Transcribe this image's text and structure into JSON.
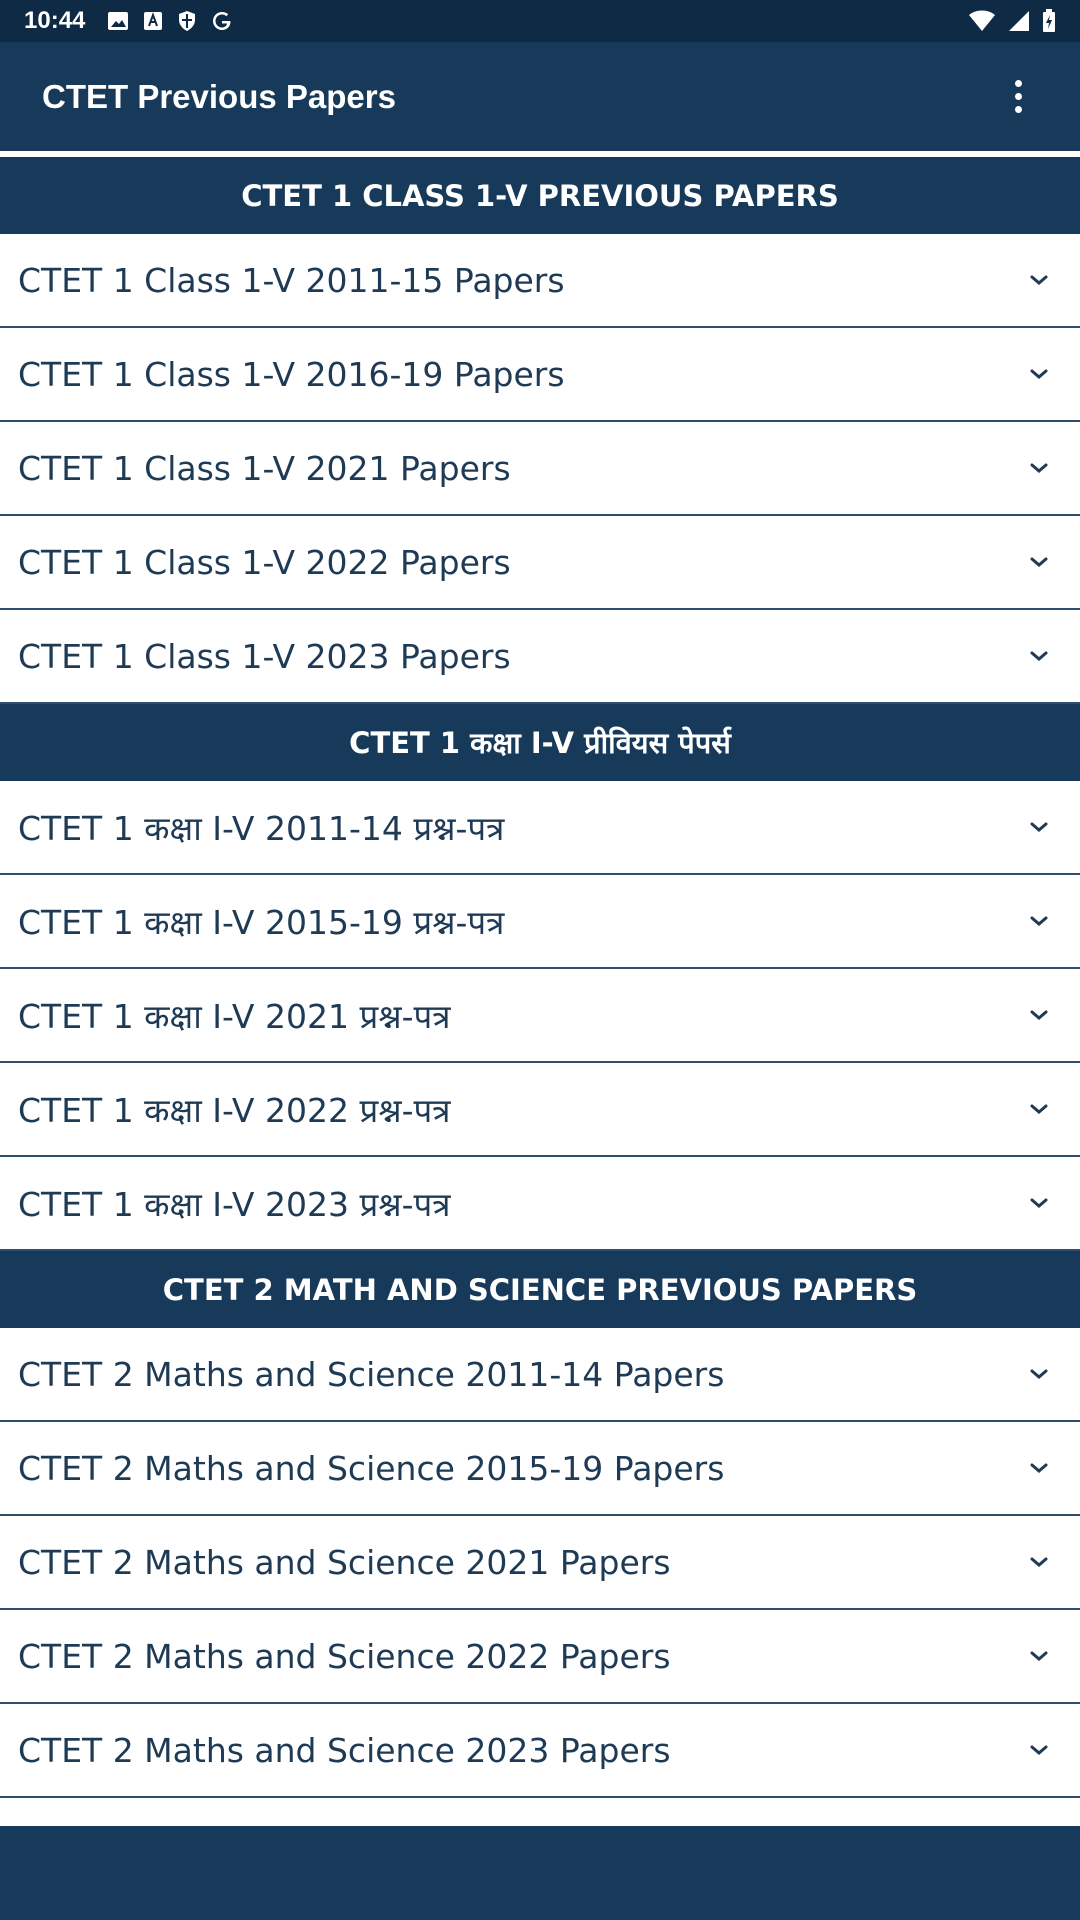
{
  "status_bar": {
    "time": "10:44",
    "left_icons": [
      "image-icon",
      "font-icon",
      "shield-icon",
      "google-icon"
    ],
    "right_icons": [
      "wifi-icon",
      "signal-icon",
      "battery-icon"
    ]
  },
  "app_bar": {
    "title": "CTET Previous Papers",
    "menu_icon": "more-vertical-icon"
  },
  "sections": [
    {
      "header": "CTET 1 CLASS 1-V PREVIOUS PAPERS",
      "items": [
        "CTET 1 Class 1-V 2011-15 Papers",
        "CTET 1 Class 1-V 2016-19 Papers",
        "CTET 1 Class 1-V 2021 Papers",
        "CTET 1 Class 1-V 2022 Papers",
        "CTET 1 Class 1-V 2023 Papers"
      ]
    },
    {
      "header": "CTET 1 कक्षा I-V प्रीवियस पेपर्स",
      "items": [
        "CTET 1 कक्षा I-V 2011-14 प्रश्न-पत्र",
        "CTET 1 कक्षा I-V 2015-19 प्रश्न-पत्र",
        "CTET 1 कक्षा I-V 2021 प्रश्न-पत्र",
        "CTET 1 कक्षा I-V 2022 प्रश्न-पत्र",
        "CTET 1 कक्षा I-V 2023 प्रश्न-पत्र"
      ]
    },
    {
      "header": "CTET 2 MATH AND SCIENCE PREVIOUS PAPERS",
      "items": [
        "CTET 2 Maths and Science 2011-14 Papers",
        "CTET 2 Maths and Science 2015-19 Papers",
        "CTET 2 Maths and Science 2021 Papers",
        "CTET 2 Maths and Science 2022 Papers",
        "CTET 2 Maths and Science 2023 Papers"
      ]
    }
  ],
  "row_icon": "chevron-down-icon",
  "colors": {
    "primary": "#183a5a",
    "status_bar": "#0f2a45",
    "row_text": "#1e3a55",
    "divider": "#2f4f6e",
    "background": "#ffffff"
  }
}
